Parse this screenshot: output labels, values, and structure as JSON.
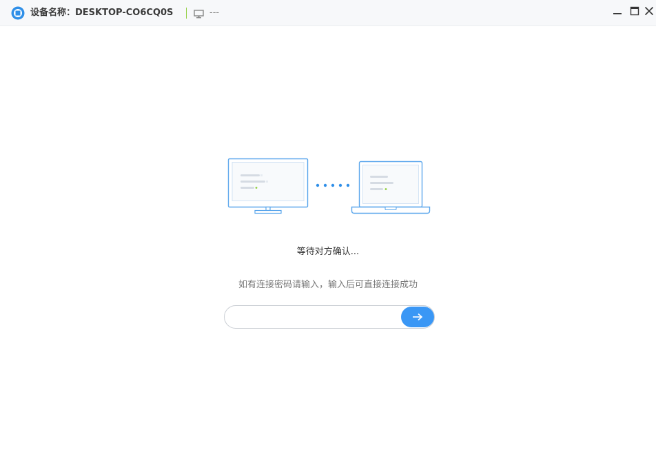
{
  "titlebar": {
    "device_name": "设备名称：DESKTOP-CO6CQ0S",
    "status": "---",
    "icons": {
      "logo": "app-logo-icon",
      "monitor": "monitor-icon",
      "minimize": "minimize-icon",
      "maximize": "maximize-icon",
      "close": "close-icon"
    }
  },
  "main": {
    "waiting_text": "等待对方确认...",
    "hint_text": "如有连接密码请输入，输入后可直接连接成功",
    "password_input": {
      "value": "",
      "placeholder": ""
    },
    "submit_icon": "arrow-right-icon"
  },
  "colors": {
    "accent": "#3a97f5",
    "logo": "#2f8fe8",
    "separator": "#8fcf3c",
    "device_outline": "#5aa6ec"
  }
}
